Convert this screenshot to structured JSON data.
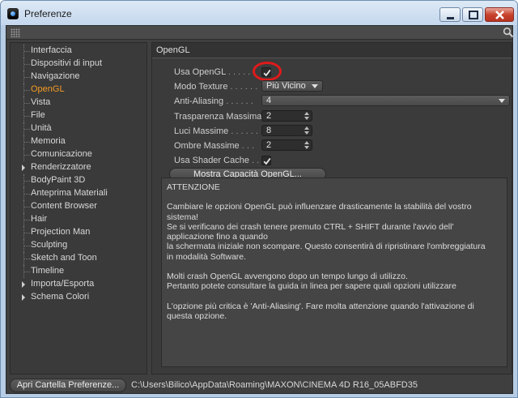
{
  "window": {
    "title": "Preferenze",
    "controls": {
      "minimize": "minimize",
      "maximize": "maximize",
      "close": "close"
    }
  },
  "sidebar": {
    "items": [
      {
        "label": "Interfaccia",
        "expandable": false,
        "active": false
      },
      {
        "label": "Dispositivi di input",
        "expandable": false,
        "active": false
      },
      {
        "label": "Navigazione",
        "expandable": false,
        "active": false
      },
      {
        "label": "OpenGL",
        "expandable": false,
        "active": true
      },
      {
        "label": "Vista",
        "expandable": false,
        "active": false
      },
      {
        "label": "File",
        "expandable": false,
        "active": false
      },
      {
        "label": "Unità",
        "expandable": false,
        "active": false
      },
      {
        "label": "Memoria",
        "expandable": false,
        "active": false
      },
      {
        "label": "Comunicazione",
        "expandable": false,
        "active": false
      },
      {
        "label": "Renderizzatore",
        "expandable": true,
        "active": false
      },
      {
        "label": "BodyPaint 3D",
        "expandable": false,
        "active": false
      },
      {
        "label": "Anteprima Materiali",
        "expandable": false,
        "active": false
      },
      {
        "label": "Content Browser",
        "expandable": false,
        "active": false
      },
      {
        "label": "Hair",
        "expandable": false,
        "active": false
      },
      {
        "label": "Projection Man",
        "expandable": false,
        "active": false
      },
      {
        "label": "Sculpting",
        "expandable": false,
        "active": false
      },
      {
        "label": "Sketch and Toon",
        "expandable": false,
        "active": false
      },
      {
        "label": "Timeline",
        "expandable": false,
        "active": false
      },
      {
        "label": "Importa/Esporta",
        "expandable": true,
        "active": false
      },
      {
        "label": "Schema Colori",
        "expandable": true,
        "active": false
      }
    ]
  },
  "panel": {
    "title": "OpenGL",
    "fields": {
      "usa_opengl": {
        "label": "Usa OpenGL",
        "dots": ". . . . .",
        "checked": true
      },
      "modo_texture": {
        "label": "Modo Texture",
        "dots": ". . . . . .",
        "value": "Più Vicino"
      },
      "anti_aliasing": {
        "label": "Anti-Aliasing",
        "dots": ". . . . . .",
        "value": "4"
      },
      "trasparenza": {
        "label": "Trasparenza Massima",
        "dots": "",
        "value": "2"
      },
      "luci": {
        "label": "Luci Massime",
        "dots": ". . . . . .",
        "value": "8"
      },
      "ombre": {
        "label": "Ombre Massime",
        "dots": ". . .",
        "value": "2"
      },
      "shader_cache": {
        "label": "Usa Shader Cache",
        "dots": ". . .",
        "checked": true
      }
    },
    "capabilities_button": "Mostra Capacità OpenGL...",
    "warning": {
      "heading": "ATTENZIONE",
      "para1": "Cambiare le opzioni OpenGL può influenzare drasticamente la stabilità del vostro\nsistema!\nSe si verificano dei crash tenere premuto CTRL + SHIFT durante l'avvio dell'\napplicazione fino a quando\nla schermata iniziale non scompare. Questo consentirà di ripristinare l'ombreggiatura\nin modalità Software.",
      "para2": "Molti crash OpenGL avvengono dopo un tempo lungo di utilizzo.\n Pertanto potete consultare la guida in linea per sapere quali opzioni utilizzare",
      "para3": "L'opzione più critica è 'Anti-Aliasing'. Fare molta attenzione quando l'attivazione di\nquesta opzione."
    }
  },
  "footer": {
    "open_folder_button": "Apri Cartella Preferenze...",
    "path": "C:\\Users\\Bilico\\AppData\\Roaming\\MAXON\\CINEMA 4D R16_05ABFD35"
  },
  "colors": {
    "active_item": "#f39b24",
    "panel_bg": "#3b3b3b",
    "highlight_ring": "#e01a1a"
  },
  "icons": [
    "app-icon",
    "grip-icon",
    "search-icon",
    "checkmark-icon",
    "caret-down-icon"
  ]
}
